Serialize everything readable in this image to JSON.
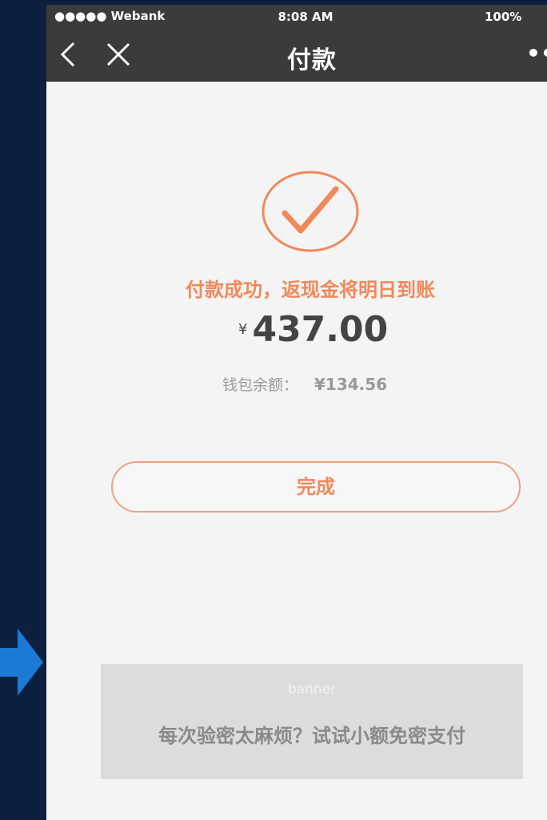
{
  "status_bar": {
    "carrier": "●●●●● Webank",
    "time": "8:08 AM",
    "battery": "100%"
  },
  "nav": {
    "title": "付款",
    "back_icon": "chevron-left-icon",
    "close_icon": "close-icon",
    "more_icon": "more-dots-icon"
  },
  "result": {
    "icon": "check-circle-icon",
    "message": "付款成功，返现金将明日到账",
    "currency": "¥",
    "amount": "437.00",
    "balance_label": "钱包余额：",
    "balance_value": "¥134.56"
  },
  "actions": {
    "done_label": "完成"
  },
  "banner": {
    "label": "banner",
    "text": "每次验密太麻烦？试试小额免密支付"
  },
  "colors": {
    "accent": "#f0895a",
    "navbar": "#3b3b3b",
    "page_bg": "#f4f4f4",
    "outer_bg": "#0d1f3f",
    "arrow": "#1a7ad4"
  }
}
